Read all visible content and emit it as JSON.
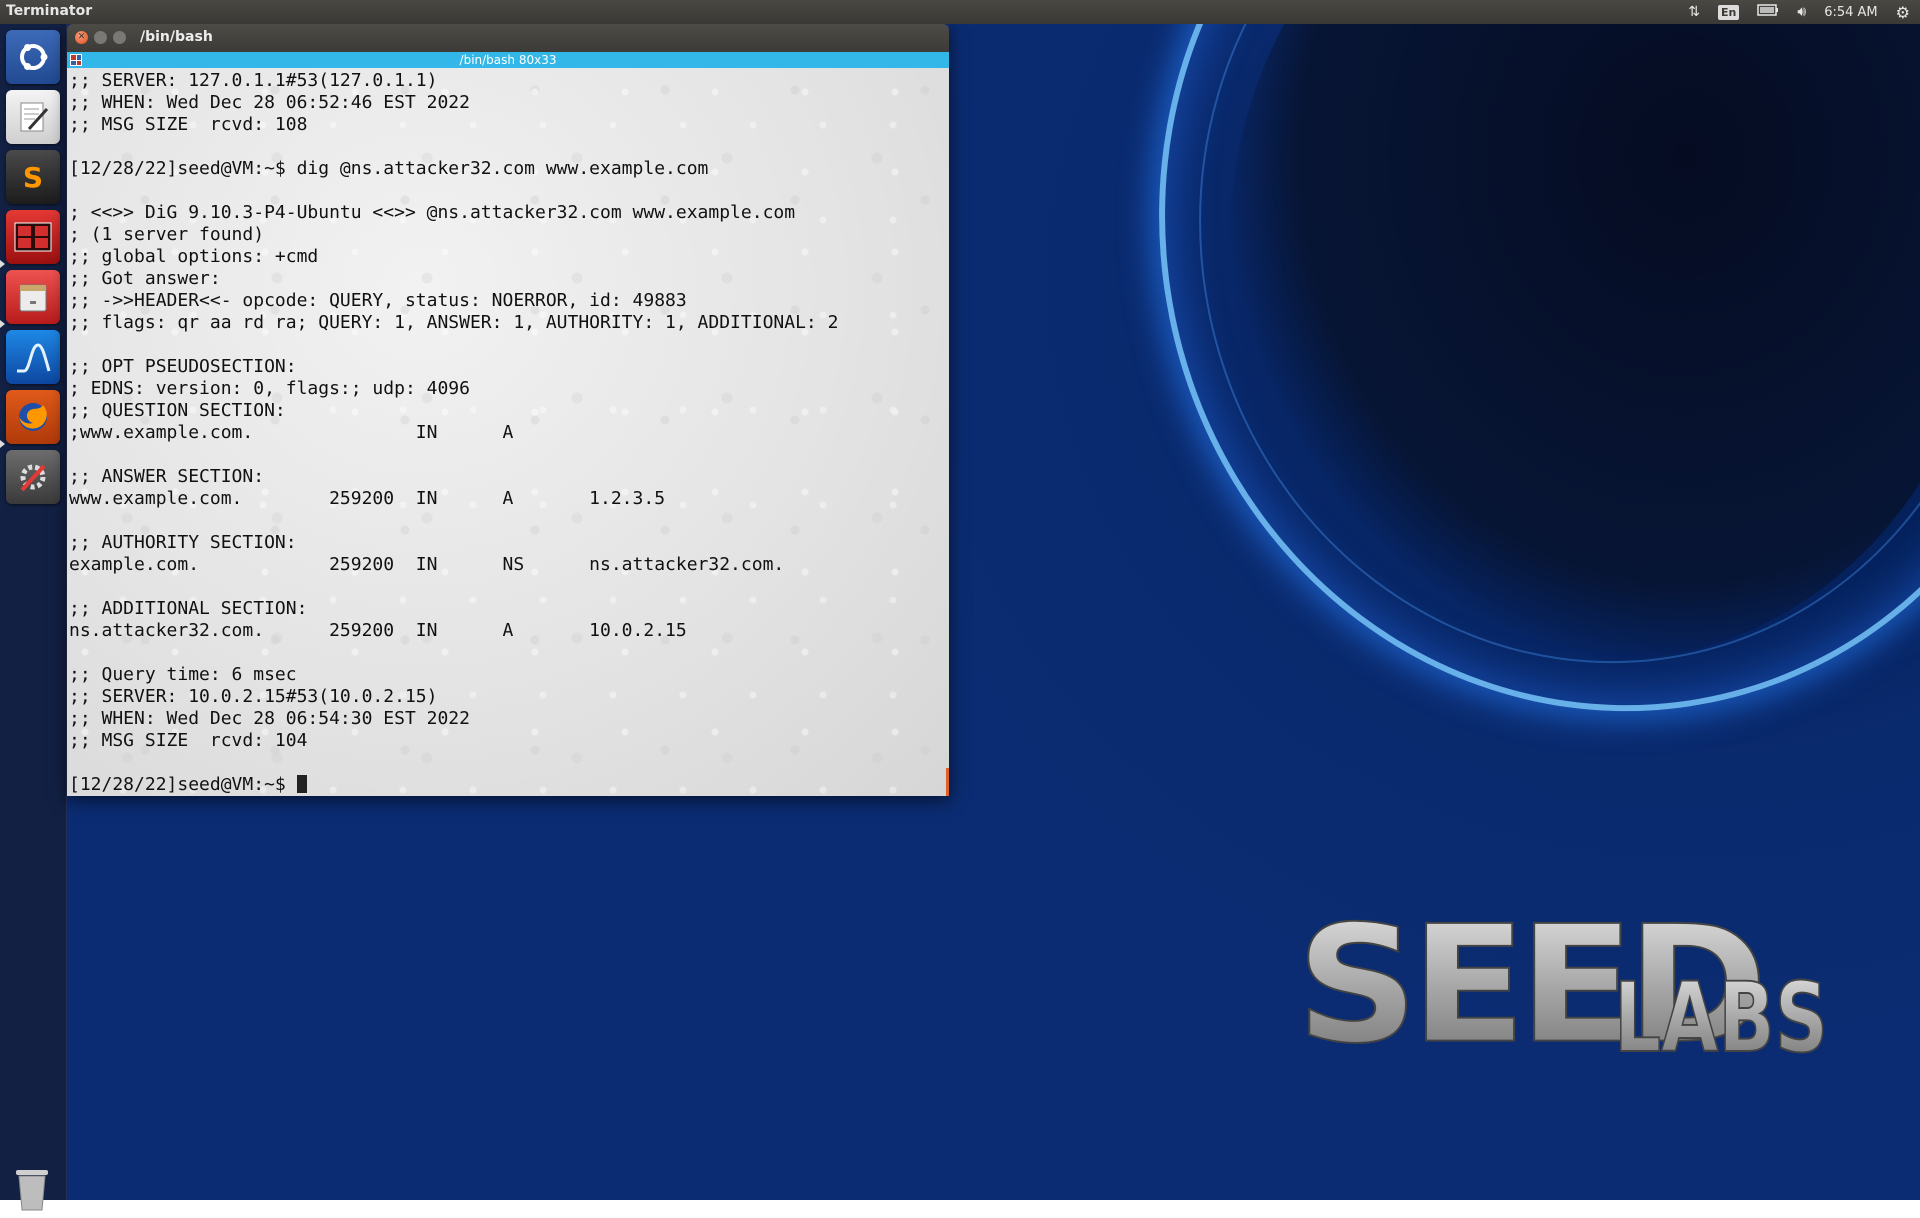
{
  "top_panel": {
    "app_title": "Terminator",
    "language": "En",
    "clock": "6:54 AM",
    "icons": [
      "network-arrows-icon",
      "keyboard-language-icon",
      "battery-icon",
      "volume-icon",
      "settings-gear-icon"
    ]
  },
  "launcher": {
    "items": [
      {
        "name": "dash-home",
        "icon": "ubuntu-logo-icon"
      },
      {
        "name": "text-editor",
        "icon": "text-editor-icon"
      },
      {
        "name": "sublime-text",
        "icon": "sublime-text-icon",
        "glyph": "S"
      },
      {
        "name": "terminator",
        "icon": "terminator-icon"
      },
      {
        "name": "file-manager",
        "icon": "file-cabinet-icon"
      },
      {
        "name": "wireshark",
        "icon": "wireshark-fin-icon"
      },
      {
        "name": "firefox",
        "icon": "firefox-icon"
      },
      {
        "name": "system-settings",
        "icon": "wrench-settings-icon"
      }
    ],
    "trash_icon": "trash-icon"
  },
  "terminal": {
    "window_title": "/bin/bash",
    "tab_title": "/bin/bash 80x33",
    "lines": [
      ";; SERVER: 127.0.1.1#53(127.0.1.1)",
      ";; WHEN: Wed Dec 28 06:52:46 EST 2022",
      ";; MSG SIZE  rcvd: 108",
      "",
      "[12/28/22]seed@VM:~$ dig @ns.attacker32.com www.example.com",
      "",
      "; <<>> DiG 9.10.3-P4-Ubuntu <<>> @ns.attacker32.com www.example.com",
      "; (1 server found)",
      ";; global options: +cmd",
      ";; Got answer:",
      ";; ->>HEADER<<- opcode: QUERY, status: NOERROR, id: 49883",
      ";; flags: qr aa rd ra; QUERY: 1, ANSWER: 1, AUTHORITY: 1, ADDITIONAL: 2",
      "",
      ";; OPT PSEUDOSECTION:",
      "; EDNS: version: 0, flags:; udp: 4096",
      ";; QUESTION SECTION:",
      ";www.example.com.               IN      A",
      "",
      ";; ANSWER SECTION:",
      "www.example.com.        259200  IN      A       1.2.3.5",
      "",
      ";; AUTHORITY SECTION:",
      "example.com.            259200  IN      NS      ns.attacker32.com.",
      "",
      ";; ADDITIONAL SECTION:",
      "ns.attacker32.com.      259200  IN      A       10.0.2.15",
      "",
      ";; Query time: 6 msec",
      ";; SERVER: 10.0.2.15#53(10.0.2.15)",
      ";; WHEN: Wed Dec 28 06:54:30 EST 2022",
      ";; MSG SIZE  rcvd: 104",
      ""
    ],
    "prompt": "[12/28/22]seed@VM:~$ "
  },
  "wallpaper": {
    "logo_main": "SEED",
    "logo_sub": "LABS",
    "colors": {
      "background": "#0b2c72",
      "ring_glow": "#3a8cff"
    }
  },
  "colors": {
    "tab_accent": "#33b7e8",
    "close_button": "#df4b16",
    "panel": "#3c3b37"
  }
}
